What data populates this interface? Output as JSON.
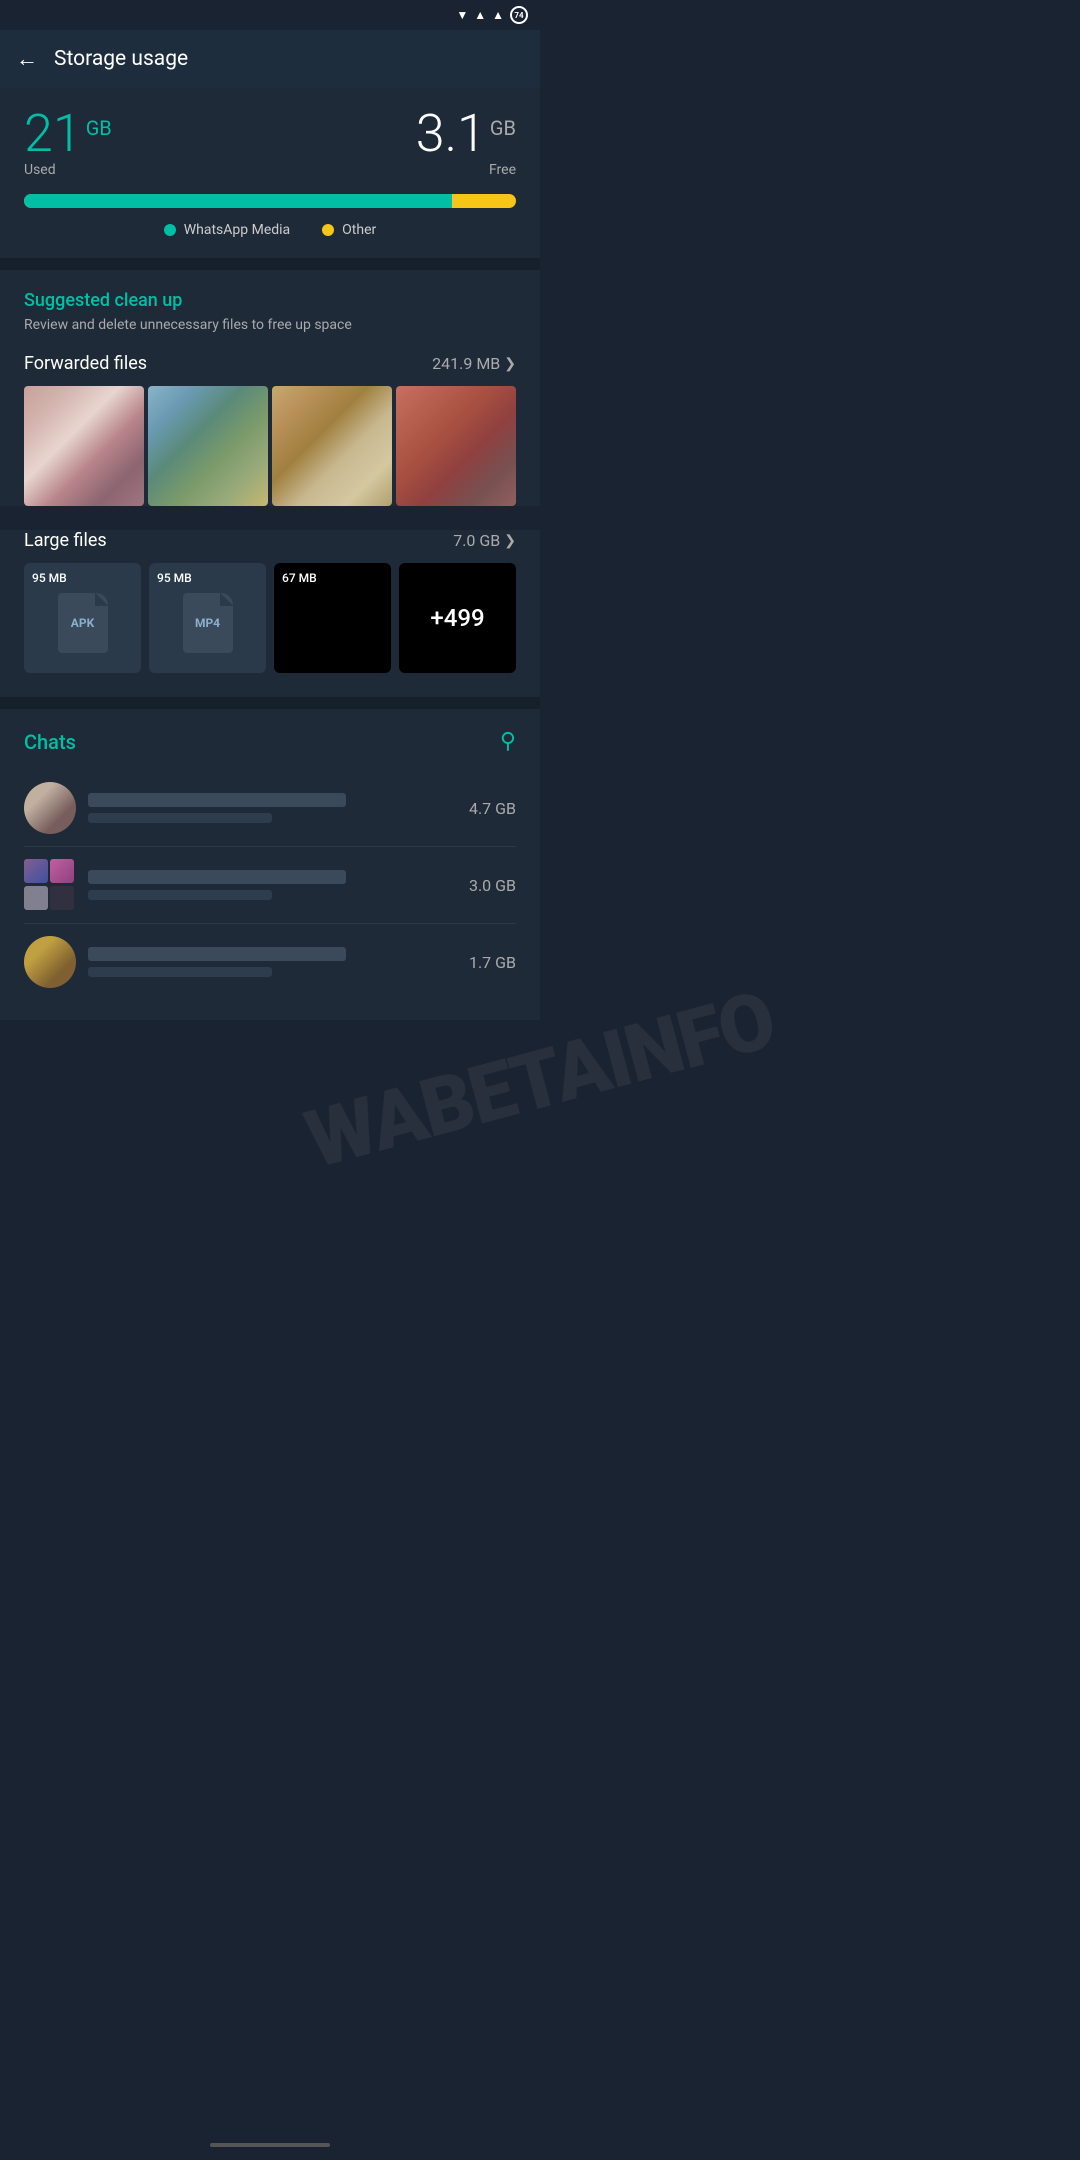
{
  "statusBar": {
    "battery": "74"
  },
  "header": {
    "title": "Storage usage",
    "backLabel": "back"
  },
  "storageOverview": {
    "usedNumber": "21",
    "usedUnit": "GB",
    "usedLabel": "Used",
    "freeNumber": "3.1",
    "freeUnit": "GB",
    "freeLabel": "Free",
    "usedPercent": 87,
    "legend": [
      {
        "label": "WhatsApp Media",
        "color": "teal"
      },
      {
        "label": "Other",
        "color": "yellow"
      }
    ]
  },
  "suggestedCleanup": {
    "title": "Suggested clean up",
    "subtitle": "Review and delete unnecessary files to free up space",
    "forwardedFiles": {
      "label": "Forwarded files",
      "size": "241.9 MB"
    },
    "largeFiles": {
      "label": "Large files",
      "size": "7.0 GB",
      "files": [
        {
          "size": "95 MB",
          "type": "APK"
        },
        {
          "size": "95 MB",
          "type": "MP4"
        },
        {
          "size": "67 MB",
          "type": ""
        },
        {
          "size": "+499",
          "type": "more"
        }
      ]
    }
  },
  "chats": {
    "title": "Chats",
    "searchIconLabel": "search",
    "items": [
      {
        "size": "4.7 GB"
      },
      {
        "size": "3.0 GB"
      },
      {
        "size": "1.7 GB"
      }
    ]
  },
  "watermark": "WABETAINFO",
  "bottomNav": {}
}
